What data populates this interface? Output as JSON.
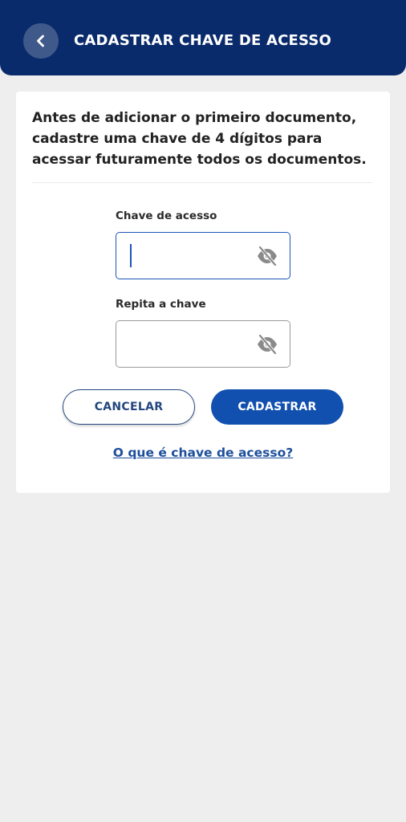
{
  "header": {
    "title": "CADASTRAR CHAVE DE ACESSO",
    "back_icon": "chevron-left-icon"
  },
  "card": {
    "intro": "Antes de adicionar o primeiro documento, cadastre uma chave de 4 dígitos para acessar futuramente todos os documentos.",
    "key_field": {
      "label": "Chave de acesso",
      "value": "",
      "icon": "eye-off-icon"
    },
    "repeat_field": {
      "label": "Repita a chave",
      "value": "",
      "icon": "eye-off-icon"
    },
    "cancel_label": "CANCELAR",
    "submit_label": "CADASTRAR",
    "help_link": "O que é chave de acesso?"
  },
  "colors": {
    "header_bg": "#0a2b6b",
    "primary": "#1250b0",
    "link": "#1d4f9c",
    "page_bg": "#eeeeee"
  }
}
